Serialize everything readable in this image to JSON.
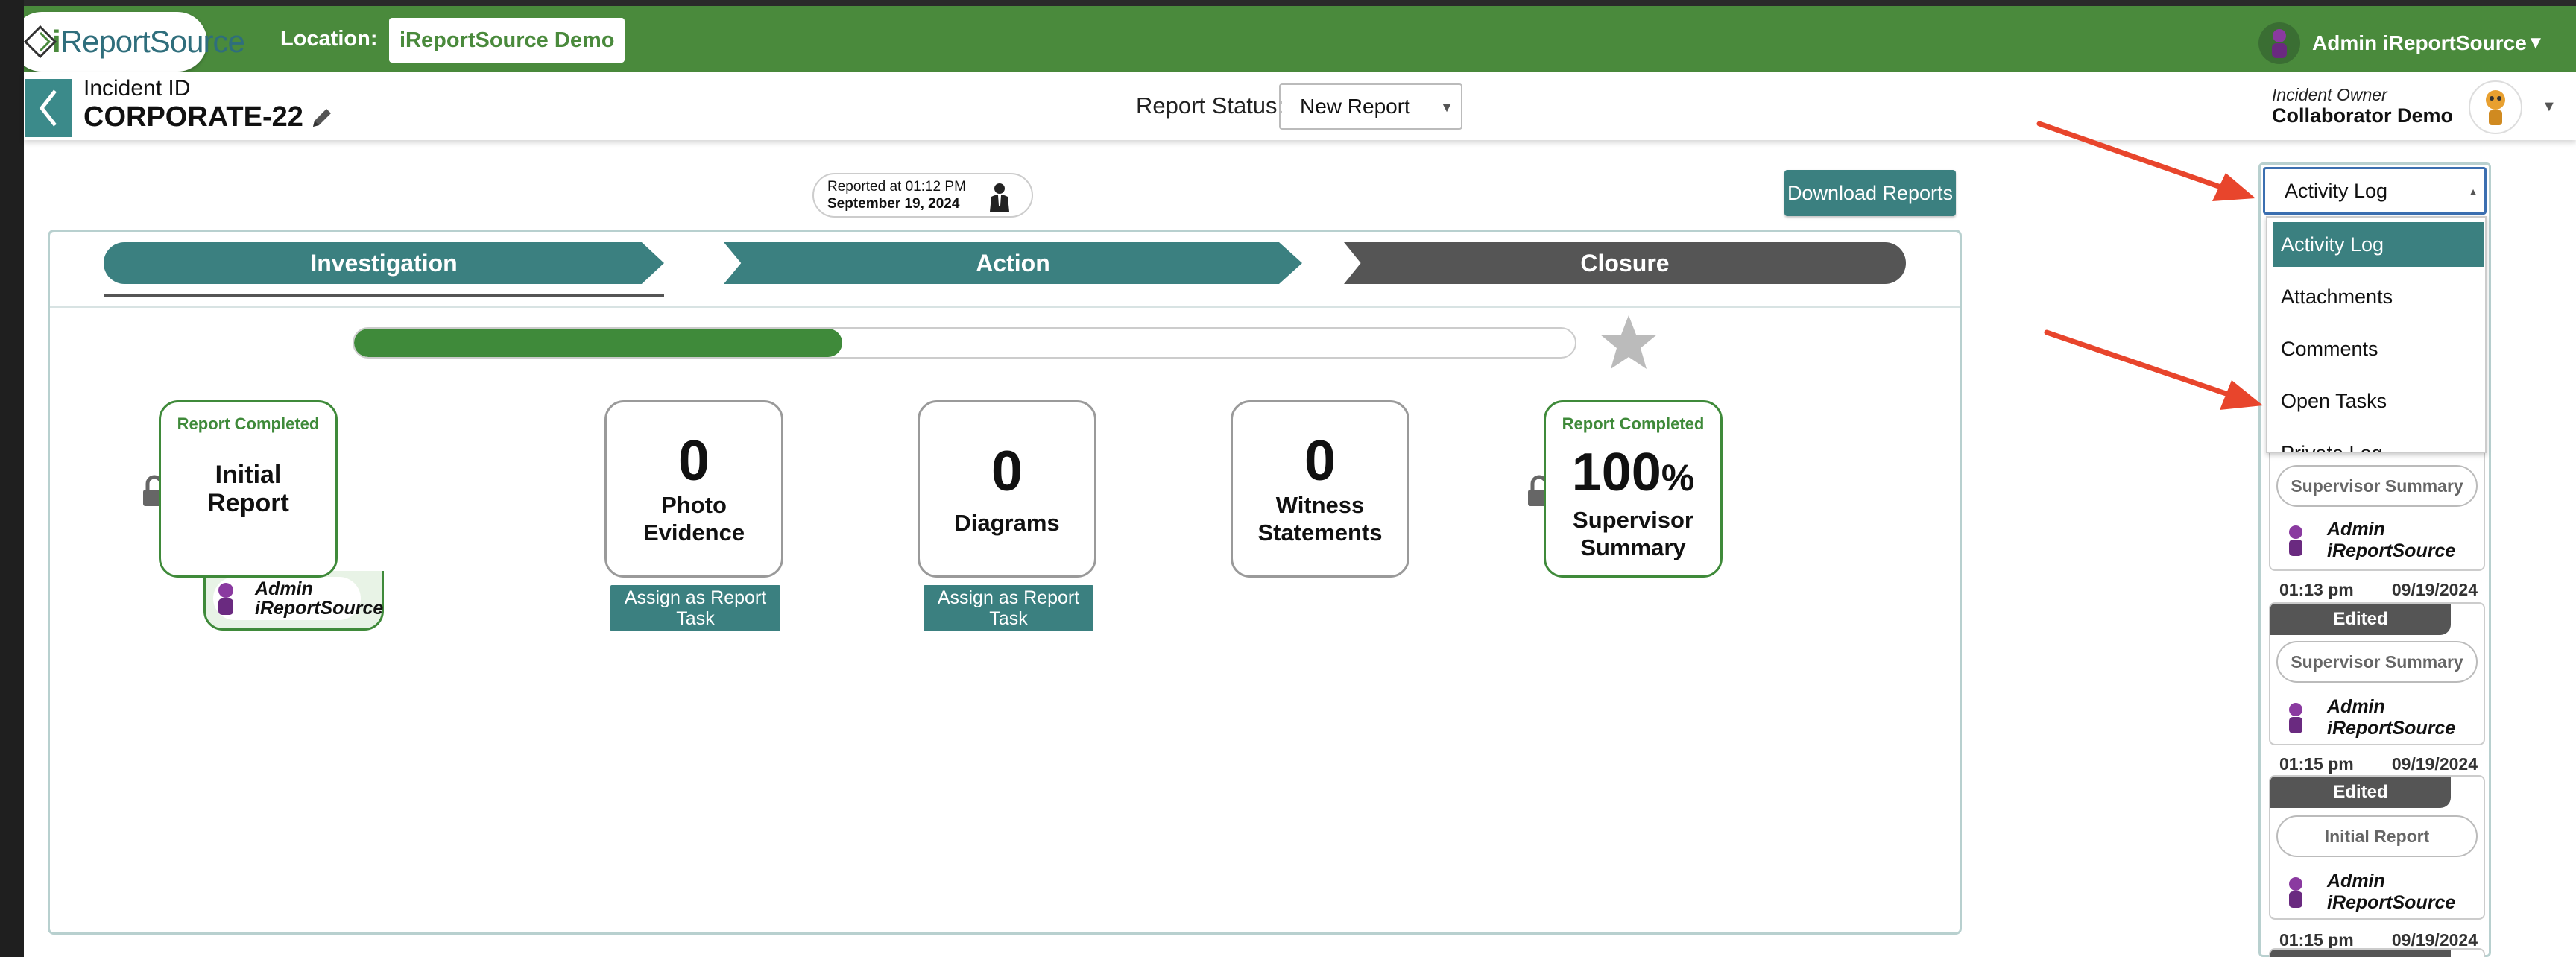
{
  "header": {
    "logo_text_i": "i",
    "logo_text_rest": "ReportSource",
    "location_label": "Location:",
    "location_value": "iReportSource Demo",
    "user_name": "Admin iReportSource"
  },
  "incident": {
    "id_label": "Incident ID",
    "id_value": "CORPORATE-22",
    "report_status_label": "Report Status:",
    "report_status_value": "New Report",
    "owner_label": "Incident Owner",
    "owner_name": "Collaborator Demo"
  },
  "reported": {
    "line1": "Reported at 01:12 PM",
    "line2": "September 19, 2024"
  },
  "download_button": "Download Reports",
  "stages": [
    "Investigation",
    "Action",
    "Closure"
  ],
  "progress_fraction": 0.4,
  "cards": {
    "initial_report": {
      "badge": "Report Completed",
      "title_l1": "Initial",
      "title_l2": "Report",
      "signer_l1": "Admin",
      "signer_l2": "iReportSource"
    },
    "photo_evidence": {
      "count": "0",
      "label_l1": "Photo",
      "label_l2": "Evidence",
      "assign": "Assign as Report Task"
    },
    "diagrams": {
      "count": "0",
      "label": "Diagrams",
      "assign": "Assign as Report Task"
    },
    "witness": {
      "count": "0",
      "label_l1": "Witness",
      "label_l2": "Statements"
    },
    "supervisor": {
      "badge": "Report Completed",
      "pct": "100",
      "pct_sign": "%",
      "label_l1": "Supervisor",
      "label_l2": "Summary"
    }
  },
  "sidebar": {
    "selected": "Activity Log",
    "options": [
      "Activity Log",
      "Attachments",
      "Comments",
      "Open Tasks",
      "Private Log"
    ],
    "entries": [
      {
        "tag": "",
        "item": "Supervisor Summary",
        "user_l1": "Admin",
        "user_l2": "iReportSource",
        "time": "01:13 pm",
        "date": "09/19/2024"
      },
      {
        "tag": "Edited",
        "item": "Supervisor Summary",
        "user_l1": "Admin",
        "user_l2": "iReportSource",
        "time": "01:15 pm",
        "date": "09/19/2024"
      },
      {
        "tag": "Edited",
        "item": "Initial Report",
        "user_l1": "Admin",
        "user_l2": "iReportSource",
        "time": "01:15 pm",
        "date": "09/19/2024"
      }
    ]
  },
  "colors": {
    "brand_green": "#4a8a3c",
    "teal": "#3b8080",
    "arrow_red": "#e8452c"
  },
  "icons": [
    "logo-icon",
    "user-avatar-icon",
    "back-chevron-icon",
    "pencil-icon",
    "reporter-icon",
    "star-icon",
    "lock-icon",
    "red-arrow-icon"
  ]
}
